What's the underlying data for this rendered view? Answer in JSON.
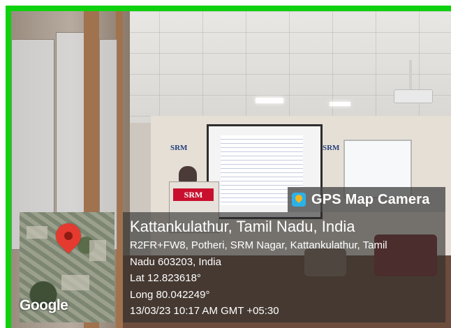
{
  "badge": {
    "icon": "map-pin-icon",
    "label": "GPS Map Camera"
  },
  "location": {
    "title": "Kattankulathur, Tamil Nadu, India",
    "address_line1": "R2FR+FW8, Potheri, SRM Nagar, Kattankulathur, Tamil",
    "address_line2": "Nadu 603203, India",
    "latitude": "Lat 12.823618°",
    "longitude": "Long 80.042249°",
    "timestamp": "13/03/23 10:17 AM GMT +05:30"
  },
  "map": {
    "provider_label": "Google",
    "pin_color": "#e53a2f"
  },
  "scene": {
    "wall_logo_left": "SRM",
    "wall_logo_right": "SRM",
    "podium_logo": "SRM"
  },
  "colors": {
    "border": "#0fd20f",
    "overlay": "#2d2d2d"
  }
}
